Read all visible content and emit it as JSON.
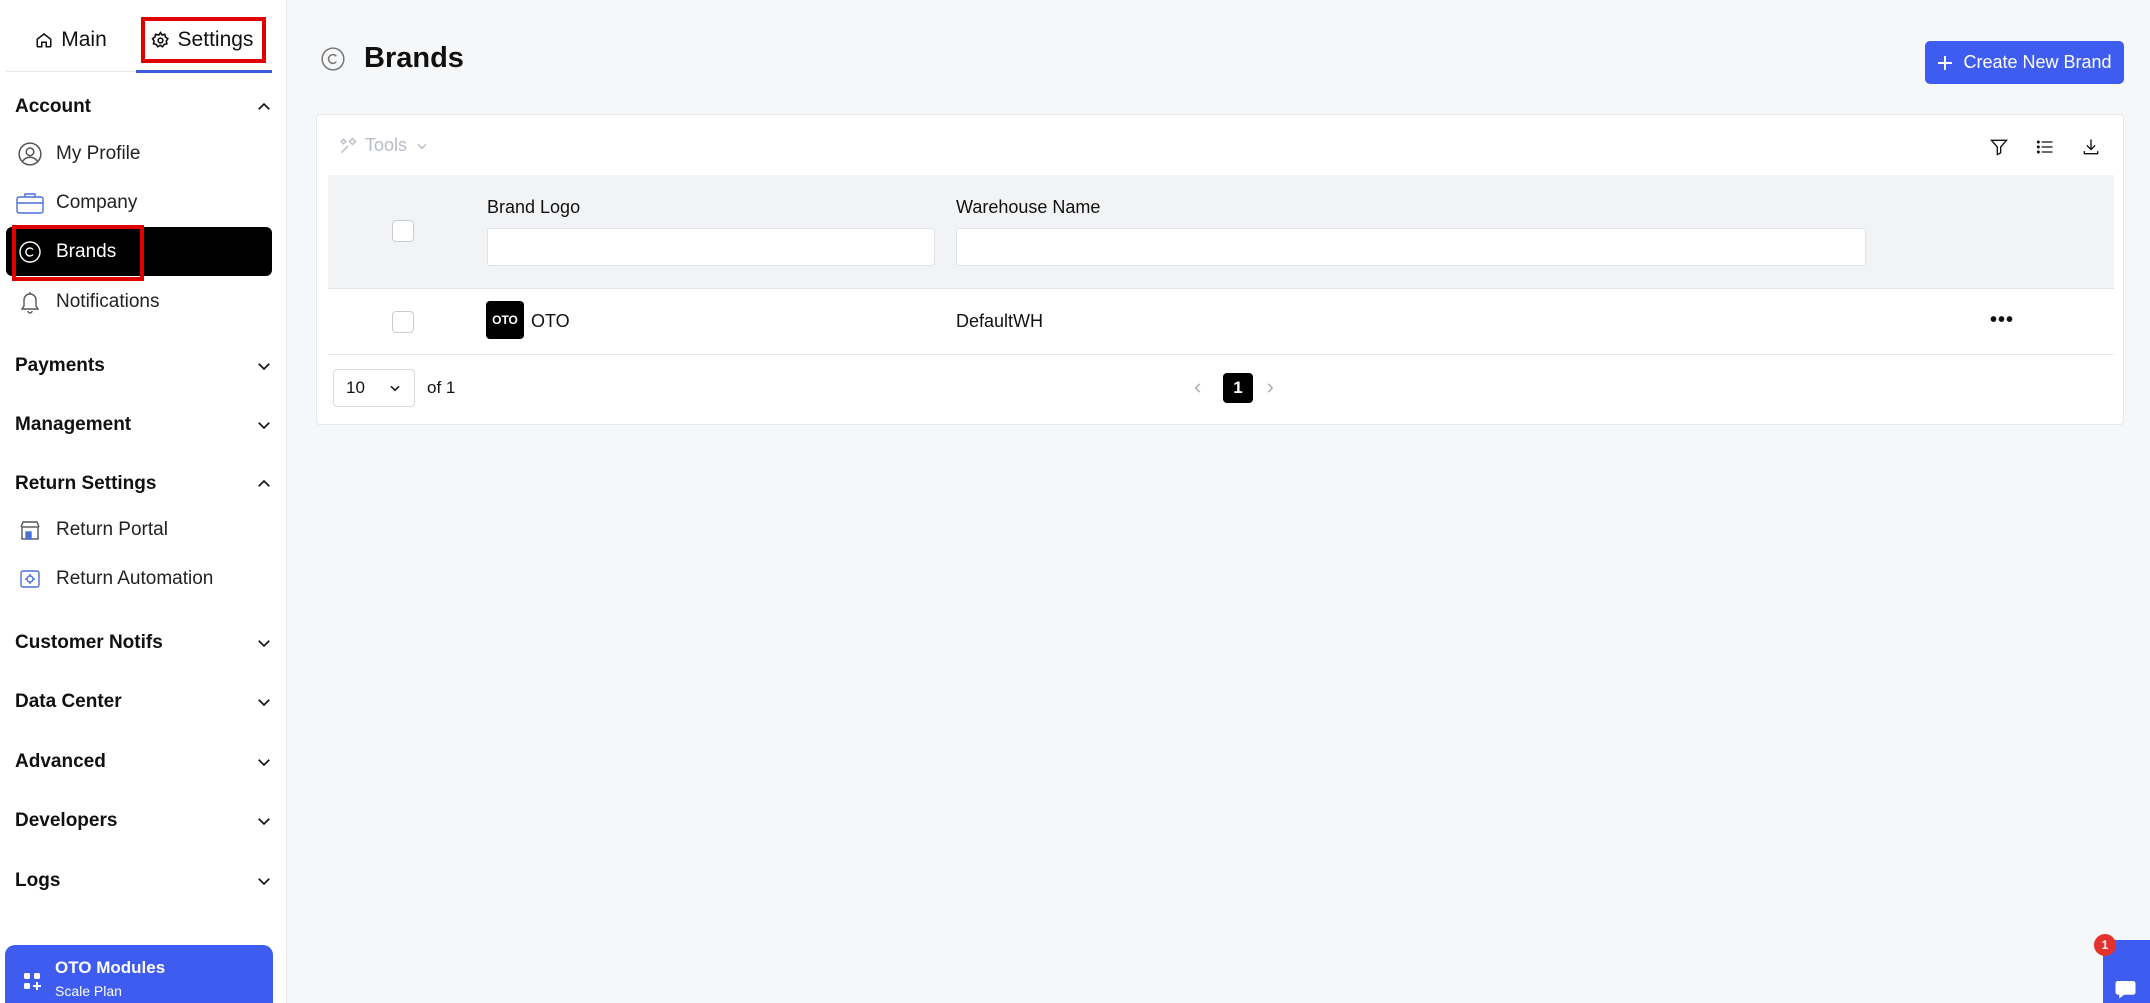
{
  "top_tabs": {
    "main": "Main",
    "settings": "Settings"
  },
  "sidebar": {
    "sections": [
      {
        "label": "Account",
        "expanded": true
      },
      {
        "label": "Payments",
        "expanded": false
      },
      {
        "label": "Management",
        "expanded": false
      },
      {
        "label": "Return Settings",
        "expanded": true
      },
      {
        "label": "Customer Notifs",
        "expanded": false
      },
      {
        "label": "Data Center",
        "expanded": false
      },
      {
        "label": "Advanced",
        "expanded": false
      },
      {
        "label": "Developers",
        "expanded": false
      },
      {
        "label": "Logs",
        "expanded": false
      }
    ],
    "account_items": [
      "My Profile",
      "Company",
      "Brands",
      "Notifications"
    ],
    "return_items": [
      "Return Portal",
      "Return Automation"
    ],
    "active_item": "Brands",
    "modules": {
      "title": "OTO Modules",
      "subtitle": "Scale Plan"
    }
  },
  "header": {
    "title": "Brands",
    "create_button": "Create New Brand"
  },
  "toolbar": {
    "tools_label": "Tools"
  },
  "table": {
    "columns": [
      "Brand Logo",
      "Warehouse Name"
    ],
    "rows": [
      {
        "logo_text": "OTO",
        "brand": "OTO",
        "warehouse": "DefaultWH",
        "actions": "•••"
      }
    ]
  },
  "pagination": {
    "page_size": "10",
    "of_label": "of 1",
    "current_page": "1"
  },
  "help": {
    "badge_count": "1"
  },
  "colors": {
    "accent": "#3f5cf0",
    "active_bg": "#000000",
    "highlight": "#e00000"
  }
}
